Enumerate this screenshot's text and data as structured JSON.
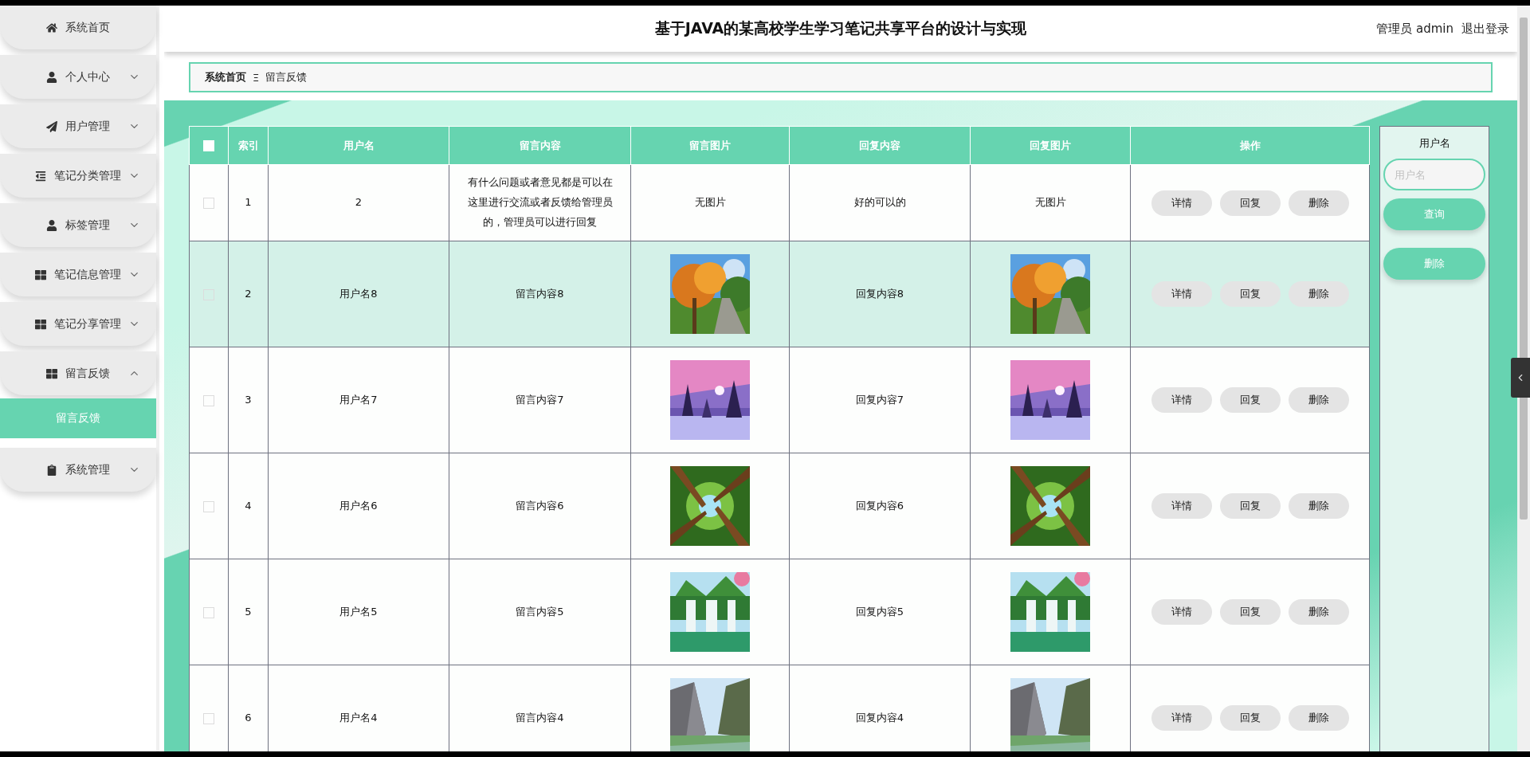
{
  "header": {
    "title": "基于JAVA的某高校学生学习笔记共享平台的设计与实现",
    "user": "管理员 admin",
    "logout": "退出登录"
  },
  "sidebar": {
    "items": [
      {
        "label": "系统首页",
        "kind": "link"
      },
      {
        "label": "个人中心",
        "kind": "menu",
        "expanded": false
      },
      {
        "label": "用户管理",
        "kind": "menu",
        "expanded": false
      },
      {
        "label": "笔记分类管理",
        "kind": "menu",
        "expanded": false
      },
      {
        "label": "标签管理",
        "kind": "menu",
        "expanded": false
      },
      {
        "label": "笔记信息管理",
        "kind": "menu",
        "expanded": false
      },
      {
        "label": "笔记分享管理",
        "kind": "menu",
        "expanded": false
      },
      {
        "label": "留言反馈",
        "kind": "menu",
        "expanded": true,
        "children": [
          {
            "label": "留言反馈",
            "selected": true
          }
        ]
      },
      {
        "label": "系统管理",
        "kind": "menu",
        "expanded": false
      }
    ]
  },
  "breadcrumb": {
    "items": [
      "系统首页",
      "留言反馈"
    ],
    "separator": "Ξ"
  },
  "table": {
    "select_all": {
      "checked": false
    },
    "columns": [
      "索引",
      "用户名",
      "留言内容",
      "留言图片",
      "回复内容",
      "回复图片",
      "操作"
    ],
    "rows": [
      {
        "checked": false,
        "selected": false,
        "index": "1",
        "username": "2",
        "message": "有什么问题或者意见都是可以在这里进行交流或者反馈给管理员的，管理员可以进行回复",
        "message_image": {
          "kind": "text",
          "text": "无图片"
        },
        "reply": "好的可以的",
        "reply_image": {
          "kind": "text",
          "text": "无图片"
        },
        "actions": [
          "详情",
          "回复",
          "删除"
        ]
      },
      {
        "checked": false,
        "selected": true,
        "index": "2",
        "username": "用户名8",
        "message": "留言内容8",
        "reply": "回复内容8",
        "actions": [
          "详情",
          "回复",
          "删除"
        ]
      },
      {
        "checked": false,
        "selected": false,
        "index": "3",
        "username": "用户名7",
        "message": "留言内容7",
        "reply": "回复内容7",
        "actions": [
          "详情",
          "回复",
          "删除"
        ]
      },
      {
        "checked": false,
        "selected": false,
        "index": "4",
        "username": "用户名6",
        "message": "留言内容6",
        "reply": "回复内容6",
        "actions": [
          "详情",
          "回复",
          "删除"
        ]
      },
      {
        "checked": false,
        "selected": false,
        "index": "5",
        "username": "用户名5",
        "message": "留言内容5",
        "reply": "回复内容5",
        "actions": [
          "详情",
          "回复",
          "删除"
        ]
      },
      {
        "checked": false,
        "selected": false,
        "index": "6",
        "username": "用户名4",
        "message": "留言内容4",
        "reply": "回复内容4",
        "actions": [
          "详情",
          "回复",
          "删除"
        ]
      }
    ]
  },
  "search": {
    "label": "用户名",
    "placeholder": "用户名",
    "buttons": [
      "查询",
      "删除"
    ]
  }
}
